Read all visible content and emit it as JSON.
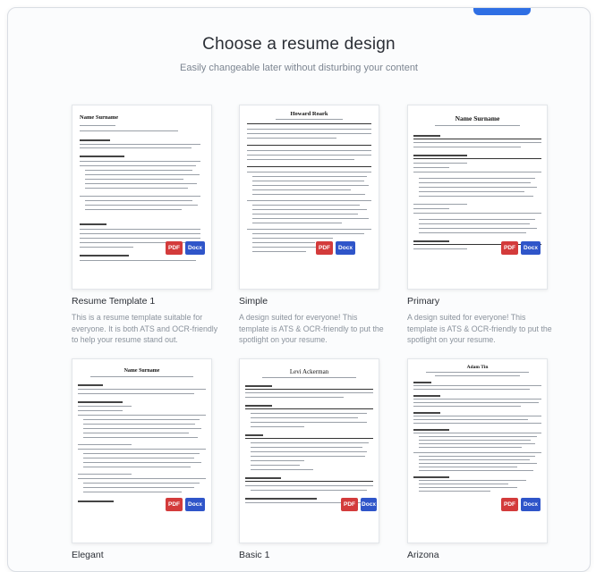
{
  "header": {
    "title": "Choose a resume design",
    "subtitle": "Easily changeable later without disturbing your content"
  },
  "templates": [
    {
      "title": "Resume Template 1",
      "description": "This is a resume template suitable for everyone. It is both ATS and OCR-friendly to help your resume stand out.",
      "preview_name": "Name Surname",
      "pdf_label": "PDF",
      "docx_label": "Docx"
    },
    {
      "title": "Simple",
      "description": "A design suited for everyone! This template is ATS & OCR-friendly to put the spotlight on your resume.",
      "preview_name": "Howard Roark",
      "pdf_label": "PDF",
      "docx_label": "Docx"
    },
    {
      "title": "Primary",
      "description": "A design suited for everyone! This template is ATS & OCR-friendly to put the spotlight on your resume.",
      "preview_name": "Name Surname",
      "pdf_label": "PDF",
      "docx_label": "Docx"
    },
    {
      "title": "Elegant",
      "description": "",
      "preview_name": "Name Surname",
      "pdf_label": "PDF",
      "docx_label": "Docx"
    },
    {
      "title": "Basic 1",
      "description": "",
      "preview_name": "Levi Ackerman",
      "pdf_label": "PDF",
      "docx_label": "Docx"
    },
    {
      "title": "Arizona",
      "description": "",
      "preview_name": "Adam Tin",
      "pdf_label": "PDF",
      "docx_label": "Docx"
    }
  ],
  "colors": {
    "pdf": "#d33b3b",
    "docx": "#2f55c9",
    "accent": "#2f6fe4"
  }
}
